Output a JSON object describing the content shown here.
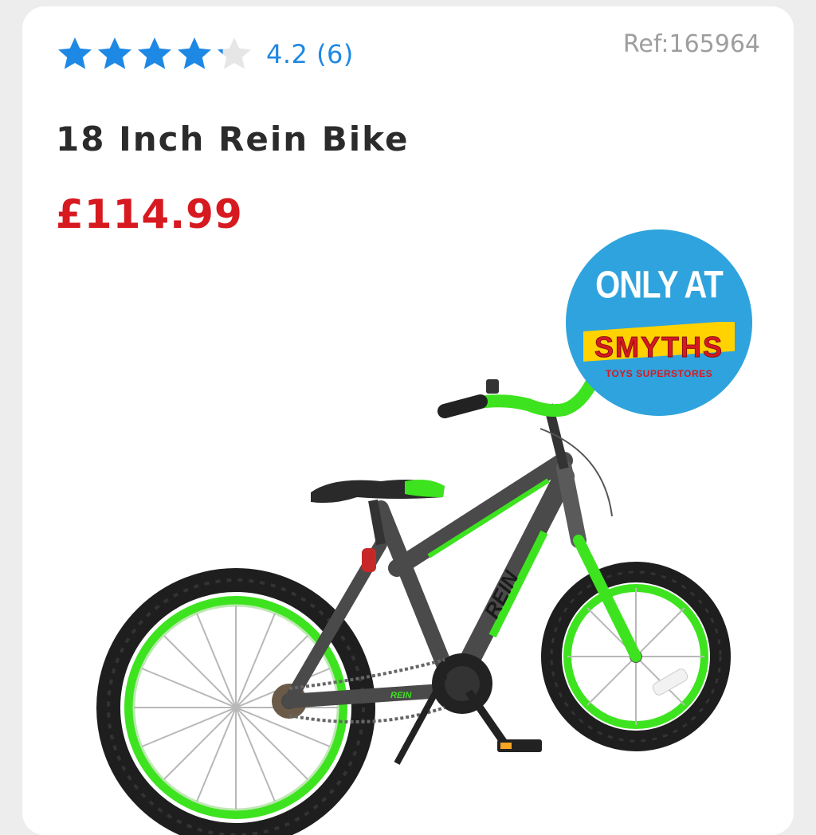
{
  "product": {
    "rating_value": 4.2,
    "stars_filled_fraction": 0.84,
    "rating_text": "4.2 (6)",
    "ref": "Ref:165964",
    "title": "18 Inch Rein Bike",
    "price": "£114.99"
  },
  "badge": {
    "line1": "ONLY AT",
    "logo_text": "SMYTHS",
    "subtitle": "TOYS SUPERSTORES"
  },
  "bike": {
    "frame_text": "REIN",
    "chainguard_text": "REIN"
  },
  "colors": {
    "star": "#1e88e5",
    "price": "#d71920",
    "badge": "#2fa3dd",
    "bike_green": "#3ee31f",
    "frame": "#4a4a4a"
  },
  "icons": {
    "rating": "star-icon",
    "badge": "smyths-badge"
  }
}
